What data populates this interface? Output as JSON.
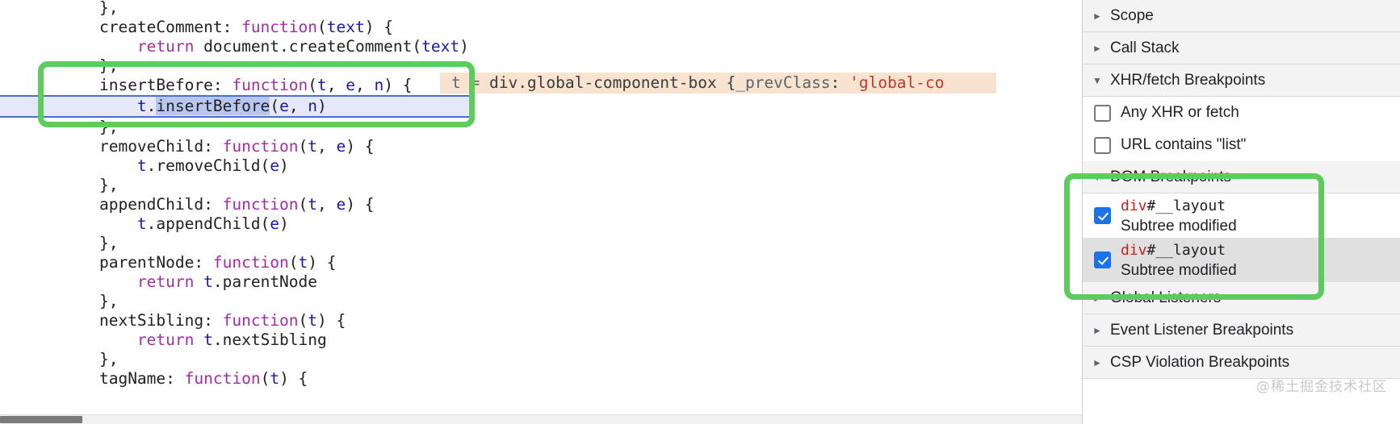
{
  "editor": {
    "language": "javascript",
    "lines": [
      {
        "indent": 1,
        "tokens": [
          {
            "t": "},",
            "c": "plain"
          }
        ]
      },
      {
        "indent": 1,
        "tokens": [
          {
            "t": "createComment: ",
            "c": "plain"
          },
          {
            "t": "function",
            "c": "kw"
          },
          {
            "t": "(",
            "c": "plain"
          },
          {
            "t": "text",
            "c": "var"
          },
          {
            "t": ") {",
            "c": "plain"
          }
        ]
      },
      {
        "indent": 2,
        "tokens": [
          {
            "t": "return",
            "c": "kw"
          },
          {
            "t": " document.createComment(",
            "c": "plain"
          },
          {
            "t": "text",
            "c": "var"
          },
          {
            "t": ")",
            "c": "plain"
          }
        ]
      },
      {
        "indent": 1,
        "tokens": [
          {
            "t": "},",
            "c": "plain"
          }
        ]
      },
      {
        "indent": 1,
        "tokens": [
          {
            "t": "insertBefore: ",
            "c": "plain"
          },
          {
            "t": "function",
            "c": "kw"
          },
          {
            "t": "(",
            "c": "plain"
          },
          {
            "t": "t",
            "c": "var"
          },
          {
            "t": ", ",
            "c": "plain"
          },
          {
            "t": "e",
            "c": "var"
          },
          {
            "t": ", ",
            "c": "plain"
          },
          {
            "t": "n",
            "c": "var"
          },
          {
            "t": ") {",
            "c": "plain"
          }
        ]
      },
      {
        "indent": 2,
        "exec": true,
        "tokens": [
          {
            "t": "t",
            "c": "var"
          },
          {
            "t": ".",
            "c": "plain"
          },
          {
            "t": "insertBefore",
            "c": "plain",
            "hl": true
          },
          {
            "t": "(",
            "c": "plain"
          },
          {
            "t": "e",
            "c": "var"
          },
          {
            "t": ", ",
            "c": "plain"
          },
          {
            "t": "n",
            "c": "var"
          },
          {
            "t": ")",
            "c": "plain"
          }
        ]
      },
      {
        "indent": 1,
        "tokens": [
          {
            "t": "},",
            "c": "plain"
          }
        ]
      },
      {
        "indent": 1,
        "tokens": [
          {
            "t": "removeChild: ",
            "c": "plain"
          },
          {
            "t": "function",
            "c": "kw"
          },
          {
            "t": "(",
            "c": "plain"
          },
          {
            "t": "t",
            "c": "var"
          },
          {
            "t": ", ",
            "c": "plain"
          },
          {
            "t": "e",
            "c": "var"
          },
          {
            "t": ") {",
            "c": "plain"
          }
        ]
      },
      {
        "indent": 2,
        "tokens": [
          {
            "t": "t",
            "c": "var"
          },
          {
            "t": ".removeChild(",
            "c": "plain"
          },
          {
            "t": "e",
            "c": "var"
          },
          {
            "t": ")",
            "c": "plain"
          }
        ]
      },
      {
        "indent": 1,
        "tokens": [
          {
            "t": "},",
            "c": "plain"
          }
        ]
      },
      {
        "indent": 1,
        "tokens": [
          {
            "t": "appendChild: ",
            "c": "plain"
          },
          {
            "t": "function",
            "c": "kw"
          },
          {
            "t": "(",
            "c": "plain"
          },
          {
            "t": "t",
            "c": "var"
          },
          {
            "t": ", ",
            "c": "plain"
          },
          {
            "t": "e",
            "c": "var"
          },
          {
            "t": ") {",
            "c": "plain"
          }
        ]
      },
      {
        "indent": 2,
        "tokens": [
          {
            "t": "t",
            "c": "var"
          },
          {
            "t": ".appendChild(",
            "c": "plain"
          },
          {
            "t": "e",
            "c": "var"
          },
          {
            "t": ")",
            "c": "plain"
          }
        ]
      },
      {
        "indent": 1,
        "tokens": [
          {
            "t": "},",
            "c": "plain"
          }
        ]
      },
      {
        "indent": 1,
        "tokens": [
          {
            "t": "parentNode: ",
            "c": "plain"
          },
          {
            "t": "function",
            "c": "kw"
          },
          {
            "t": "(",
            "c": "plain"
          },
          {
            "t": "t",
            "c": "var"
          },
          {
            "t": ") {",
            "c": "plain"
          }
        ]
      },
      {
        "indent": 2,
        "tokens": [
          {
            "t": "return",
            "c": "kw"
          },
          {
            "t": " ",
            "c": "plain"
          },
          {
            "t": "t",
            "c": "var"
          },
          {
            "t": ".parentNode",
            "c": "plain"
          }
        ]
      },
      {
        "indent": 1,
        "tokens": [
          {
            "t": "},",
            "c": "plain"
          }
        ]
      },
      {
        "indent": 1,
        "tokens": [
          {
            "t": "nextSibling: ",
            "c": "plain"
          },
          {
            "t": "function",
            "c": "kw"
          },
          {
            "t": "(",
            "c": "plain"
          },
          {
            "t": "t",
            "c": "var"
          },
          {
            "t": ") {",
            "c": "plain"
          }
        ]
      },
      {
        "indent": 2,
        "tokens": [
          {
            "t": "return",
            "c": "kw"
          },
          {
            "t": " ",
            "c": "plain"
          },
          {
            "t": "t",
            "c": "var"
          },
          {
            "t": ".nextSibling",
            "c": "plain"
          }
        ]
      },
      {
        "indent": 1,
        "tokens": [
          {
            "t": "},",
            "c": "plain"
          }
        ]
      },
      {
        "indent": 1,
        "tokens": [
          {
            "t": "tagName: ",
            "c": "plain"
          },
          {
            "t": "function",
            "c": "kw"
          },
          {
            "t": "(",
            "c": "plain"
          },
          {
            "t": "t",
            "c": "var"
          },
          {
            "t": ") {",
            "c": "plain"
          }
        ]
      }
    ],
    "inline_value": {
      "prefix": "t = ",
      "object": "div.global-component-box ",
      "body_open": "{",
      "prop": "_prevClass",
      "colon": ": ",
      "string": "'global-co"
    }
  },
  "debugger_sidebar": {
    "sections": [
      {
        "name": "scope",
        "label": "Scope",
        "expanded": false,
        "arrow": "triangle-right-icon"
      },
      {
        "name": "call-stack",
        "label": "Call Stack",
        "expanded": false,
        "arrow": "triangle-right-icon"
      },
      {
        "name": "xhr-fetch-breakpoints",
        "label": "XHR/fetch Breakpoints",
        "expanded": true,
        "arrow": "triangle-down-icon"
      }
    ],
    "xhr_breakpoints": [
      {
        "label": "Any XHR or fetch",
        "checked": false
      },
      {
        "label": "URL contains \"list\"",
        "checked": false
      }
    ],
    "dom_breakpoints_header": {
      "label": "DOM Breakpoints",
      "expanded": true,
      "arrow": "triangle-down-icon"
    },
    "dom_breakpoints": [
      {
        "tag": "div",
        "id": "#__layout",
        "kind": "Subtree modified",
        "checked": true,
        "selected": false
      },
      {
        "tag": "div",
        "id": "#__layout",
        "kind": "Subtree modified",
        "checked": true,
        "selected": true
      }
    ],
    "trailing_sections": [
      {
        "name": "global-listeners",
        "label": "Global Listeners",
        "expanded": false,
        "arrow": "triangle-right-icon"
      },
      {
        "name": "event-listener-breakpoints",
        "label": "Event Listener Breakpoints",
        "expanded": false,
        "arrow": "triangle-right-icon"
      },
      {
        "name": "csp-violation-breakpoints",
        "label": "CSP Violation Breakpoints",
        "expanded": false,
        "arrow": "triangle-right-icon"
      }
    ]
  },
  "annotations": {
    "color": "#5ecb5e",
    "boxes": [
      {
        "name": "code-insertbefore-highlight"
      },
      {
        "name": "dom-breakpoints-highlight"
      }
    ]
  },
  "watermark": {
    "text": "@稀土掘金技术社区"
  },
  "colors": {
    "keyword": "#a32da3",
    "variable": "#1a1aa6",
    "plain": "#202124",
    "exec_line_bg": "#e4e8f8",
    "exec_line_border": "#4a6fd4",
    "inline_value_bg": "#f7e3d0",
    "inline_value_string": "#c0392b",
    "checkbox_checked": "#1a73e8",
    "dom_tag": "#c5221f",
    "annotation_green": "#5ecb5e",
    "section_header_bg": "#f3f3f3",
    "selected_row_bg": "#e0e0e0"
  }
}
